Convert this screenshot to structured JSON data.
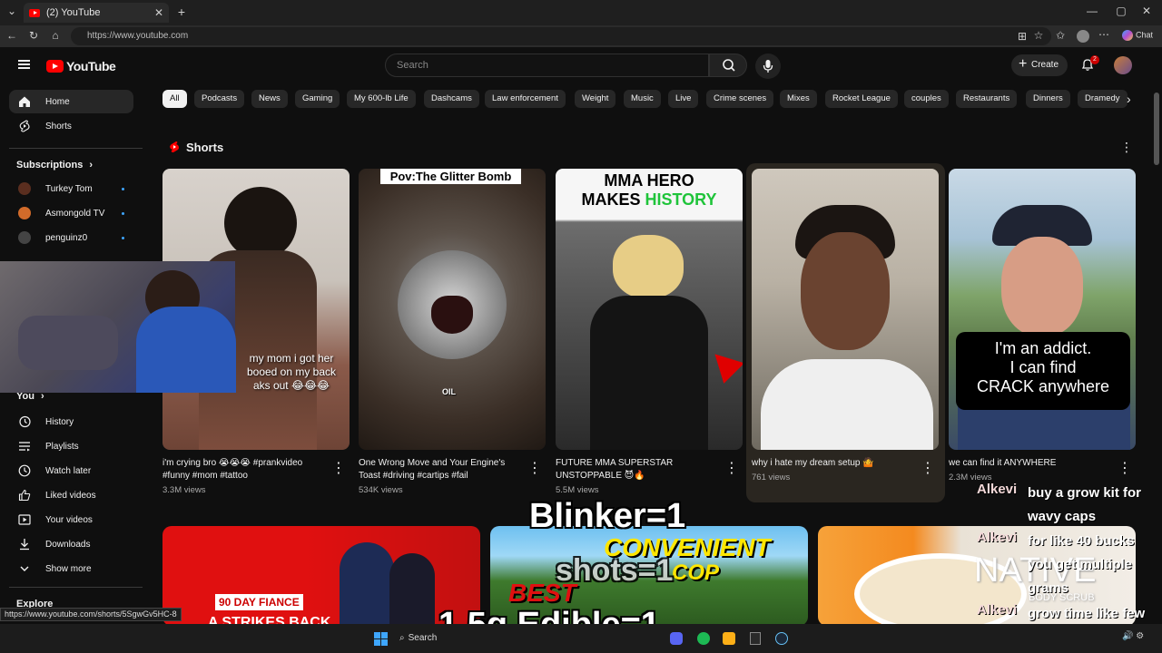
{
  "browser": {
    "tab_title": "(2) YouTube",
    "url": "https://www.youtube.com",
    "chat_label": "Chat"
  },
  "header": {
    "logo_text": "YouTube",
    "search_placeholder": "Search",
    "create_label": "Create",
    "notification_count": "2"
  },
  "sidebar": {
    "main": [
      {
        "label": "Home",
        "icon": "home-icon"
      },
      {
        "label": "Shorts",
        "icon": "shorts-icon"
      }
    ],
    "subscriptions_title": "Subscriptions",
    "subscriptions": [
      {
        "label": "Turkey Tom"
      },
      {
        "label": "Asmongold TV"
      },
      {
        "label": "penguinz0"
      }
    ],
    "you_title": "You",
    "you_items": [
      {
        "label": "History",
        "icon": "history-icon"
      },
      {
        "label": "Playlists",
        "icon": "playlists-icon"
      },
      {
        "label": "Watch later",
        "icon": "watch-later-icon"
      },
      {
        "label": "Liked videos",
        "icon": "like-icon"
      },
      {
        "label": "Your videos",
        "icon": "your-videos-icon"
      },
      {
        "label": "Downloads",
        "icon": "download-icon"
      },
      {
        "label": "Show more",
        "icon": "chevron-down-icon"
      }
    ],
    "explore_title": "Explore"
  },
  "chips": [
    "All",
    "Podcasts",
    "News",
    "Gaming",
    "My 600-lb Life",
    "Dashcams",
    "Law enforcement",
    "Weight",
    "Music",
    "Live",
    "Crime scenes",
    "Mixes",
    "Rocket League",
    "couples",
    "Restaurants",
    "Dinners",
    "Dramedy"
  ],
  "shorts": {
    "section_title": "Shorts",
    "items": [
      {
        "title": "i'm crying bro 😭😭😭 #prankvideo #funny #mom #tattoo",
        "views": "3.3M views",
        "overlay": "my mom i got her\nbooed on my back\naks out 😂😂😂"
      },
      {
        "title": "One Wrong Move and Your Engine's Toast #driving #cartips #fail",
        "views": "534K views",
        "overlay": "Pov:The Glitter Bomb",
        "overlay2": "OIL"
      },
      {
        "title": "FUTURE MMA SUPERSTAR UNSTOPPABLE 😈🔥",
        "views": "5.5M views",
        "overlay_a": "MMA HERO",
        "overlay_b": "MAKES ",
        "overlay_c": "HISTORY"
      },
      {
        "title": "why i hate my dream setup 🤷",
        "views": "761 views"
      },
      {
        "title": "we can find it ANYWHERE",
        "views": "2.3M views",
        "overlay": "I'm an addict.\nI can find\nCRACK anywhere"
      }
    ]
  },
  "bottom_row": {
    "thumb1_text": "90 DAY FIANCE",
    "thumb1_text2": "A STRIKES BACK",
    "thumb2_text": "CONVENIENT",
    "thumb2_text2": "COP",
    "thumb2_text3": "BEST",
    "thumb3_text": "NATIVE",
    "thumb3_text2": "BODY SCRUB"
  },
  "stream_overlay": {
    "line1": "Blinker=1",
    "line2": "shots=1",
    "line3": "1.5g Edible=1",
    "chat": [
      {
        "user": "Alkevi",
        "msg": "buy a grow kit for wavy caps"
      },
      {
        "user": "Alkevi",
        "msg": "for like 40 bucks you get multiple grams"
      },
      {
        "user": "Alkevi",
        "msg": "grow time like few months"
      }
    ]
  },
  "status_url": "https://www.youtube.com/shorts/5SgwGv5HC-8",
  "taskbar": {
    "search_label": "Search"
  }
}
